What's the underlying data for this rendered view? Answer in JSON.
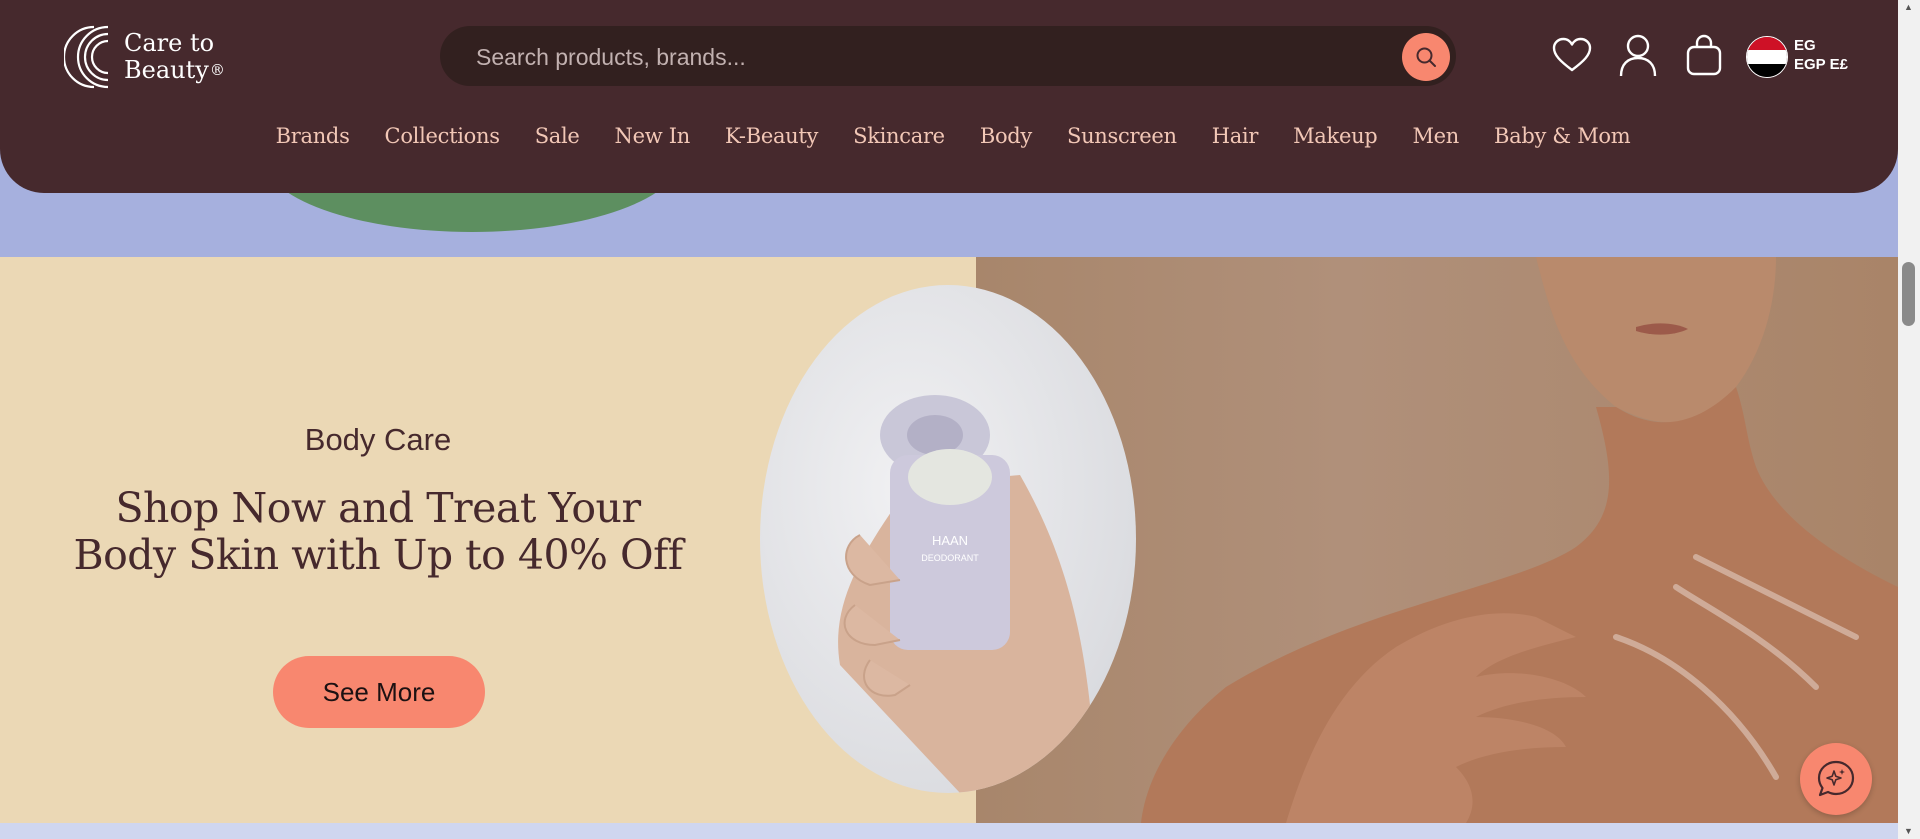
{
  "logo": {
    "line1": "Care to",
    "line2": "Beauty",
    "reg": "®"
  },
  "search": {
    "placeholder": "Search products, brands..."
  },
  "header_icons": [
    "heart-icon",
    "user-icon",
    "bag-icon"
  ],
  "locale": {
    "country": "EG",
    "currency": "EGP E£",
    "flag_colors": [
      "#ce1126",
      "#ffffff",
      "#000000"
    ]
  },
  "nav": {
    "items": [
      "Brands",
      "Collections",
      "Sale",
      "New In",
      "K-Beauty",
      "Skincare",
      "Body",
      "Sunscreen",
      "Hair",
      "Makeup",
      "Men",
      "Baby & Mom"
    ]
  },
  "banner": {
    "tagline": "Body Care",
    "headline_line1": "Shop Now and Treat Your",
    "headline_line2": "Body Skin with Up to 40% Off",
    "cta": "See More",
    "product_brand": "HAAN",
    "product_line": "DEODORANT"
  },
  "colors": {
    "header": "#46292d",
    "accent": "#f8876f",
    "banner_bg": "#ebd8b5",
    "page_bg": "#a6b0de",
    "nav_text": "#f2c7b6"
  }
}
